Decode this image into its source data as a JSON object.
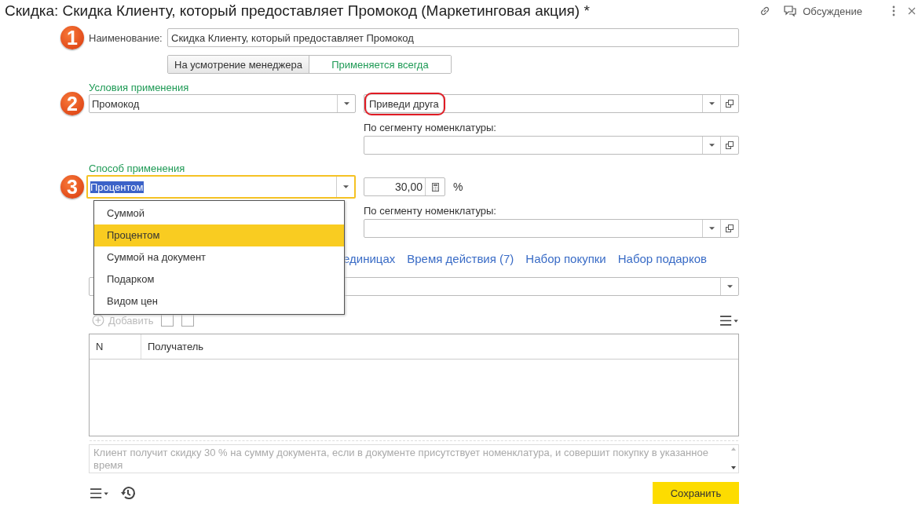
{
  "window": {
    "title": "Скидка: Скидка Клиенту, который предоставляет Промокод (Маркетинговая акция) *",
    "discussion_label": "Обсуждение"
  },
  "name_field": {
    "callout": "1",
    "label": "Наименование:",
    "value": "Скидка Клиенту, который предоставляет Промокод"
  },
  "mode_toggle": [
    {
      "label": "На усмотрение менеджера",
      "selected": false
    },
    {
      "label": "Применяется всегда",
      "selected": true
    }
  ],
  "conditions": {
    "heading": "Условия применения",
    "callout": "2",
    "type_value": "Промокод",
    "promo": {
      "value": "Приведи друга",
      "highlighted": true
    },
    "segment_label": "По сегменту номенклатуры:"
  },
  "method": {
    "heading": "Способ применения",
    "callout": "3",
    "type": {
      "value": "Процентом",
      "focused": true
    },
    "amount": "30,00",
    "unit": "%",
    "segment_label": "По сегменту номенклатуры:",
    "dropdown": [
      {
        "label": "Суммой",
        "selected": false
      },
      {
        "label": "Процентом",
        "selected": true
      },
      {
        "label": "Суммой на документ",
        "selected": false
      },
      {
        "label": "Подарком",
        "selected": false
      },
      {
        "label": "Видом цен",
        "selected": false
      }
    ]
  },
  "tabs": [
    {
      "label": "единицах"
    },
    {
      "label": "Время действия (7)"
    },
    {
      "label": "Набор покупки"
    },
    {
      "label": "Набор подарков"
    }
  ],
  "toolbar": {
    "add_label": "Добавить",
    "disabled": true
  },
  "table": {
    "columns": [
      "N",
      "Получатель"
    ]
  },
  "description": {
    "text": "Клиент получит скидку 30 % на сумму документа, если в документе присутствует номенклатура, и совершит покупку в указанное время"
  },
  "save_button": "Сохранить"
}
